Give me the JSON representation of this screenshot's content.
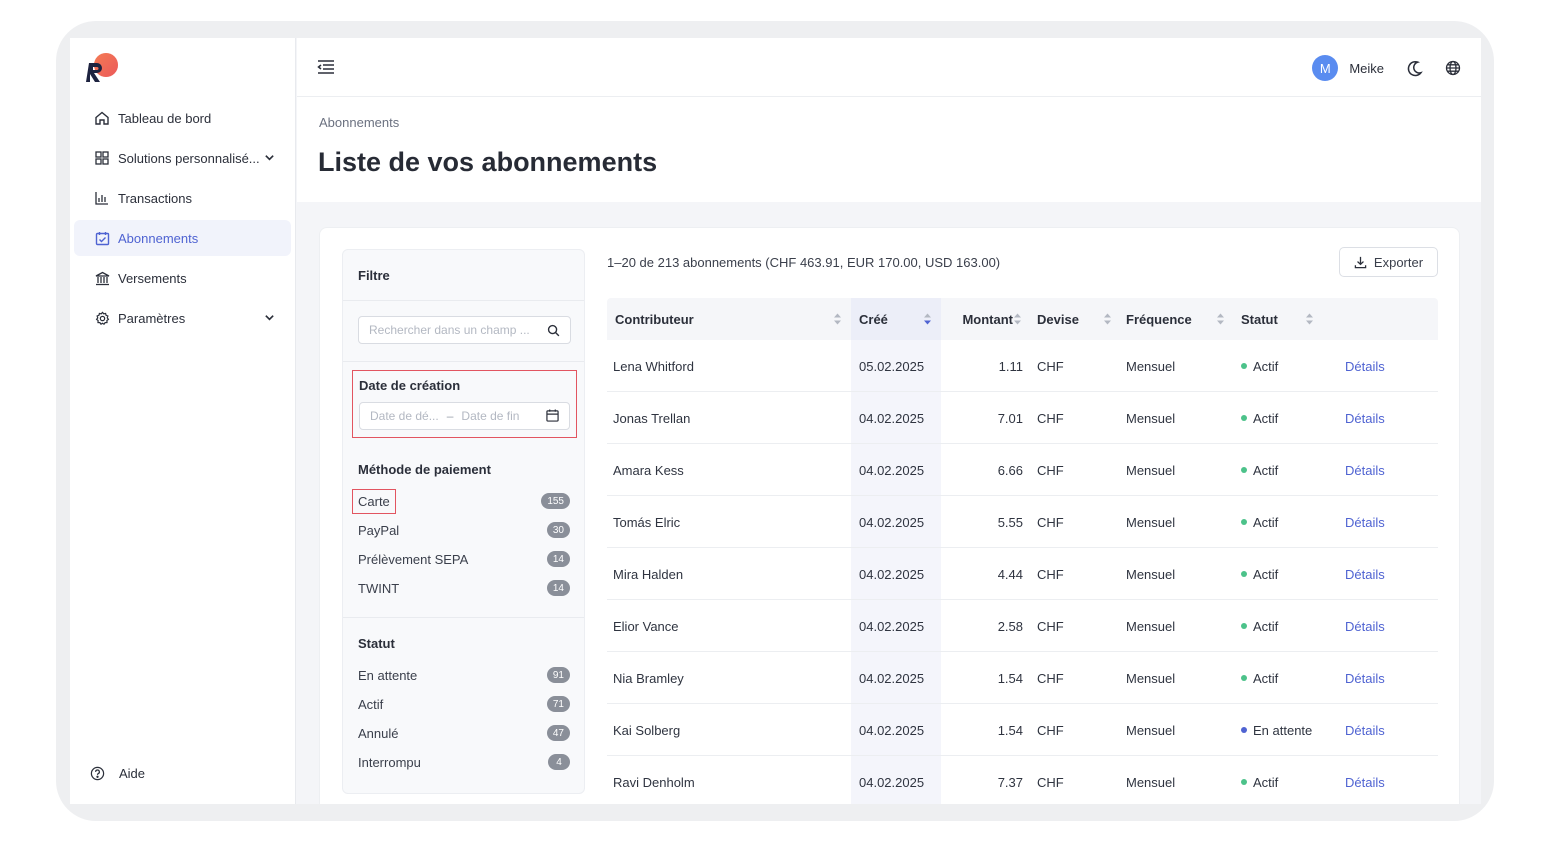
{
  "sidebar": {
    "items": [
      {
        "label": "Tableau de bord",
        "icon": "home-icon"
      },
      {
        "label": "Solutions personnalisé...",
        "icon": "grid-icon"
      },
      {
        "label": "Transactions",
        "icon": "bar-chart-icon"
      },
      {
        "label": "Abonnements",
        "icon": "calendar-check-icon"
      },
      {
        "label": "Versements",
        "icon": "bank-icon"
      },
      {
        "label": "Paramètres",
        "icon": "gear-icon"
      }
    ],
    "help_label": "Aide"
  },
  "topbar": {
    "avatar_initial": "M",
    "username": "Meike"
  },
  "header": {
    "breadcrumb": "Abonnements",
    "title": "Liste de vos abonnements"
  },
  "filter": {
    "title": "Filtre",
    "search_placeholder": "Rechercher dans un champ ...",
    "date": {
      "label": "Date de création",
      "start_placeholder": "Date de dé...",
      "end_placeholder": "Date de fin"
    },
    "payment": {
      "title": "Méthode de paiement",
      "options": [
        {
          "label": "Carte",
          "count": "155"
        },
        {
          "label": "PayPal",
          "count": "30"
        },
        {
          "label": "Prélèvement SEPA",
          "count": "14"
        },
        {
          "label": "TWINT",
          "count": "14"
        }
      ]
    },
    "status": {
      "title": "Statut",
      "options": [
        {
          "label": "En attente",
          "count": "91"
        },
        {
          "label": "Actif",
          "count": "71"
        },
        {
          "label": "Annulé",
          "count": "47"
        },
        {
          "label": "Interrompu",
          "count": "4"
        }
      ]
    }
  },
  "summary": "1–20 de 213 abonnements (CHF 463.91, EUR 170.00, USD 163.00)",
  "export_label": "Exporter",
  "table": {
    "columns": [
      "Contributeur",
      "Créé",
      "Montant",
      "Devise",
      "Fréquence",
      "Statut"
    ],
    "details_label": "Détails",
    "rows": [
      {
        "name": "Lena Whitford",
        "created": "05.02.2025",
        "amount": "1.11",
        "currency": "CHF",
        "frequency": "Mensuel",
        "status": "Actif"
      },
      {
        "name": "Jonas Trellan",
        "created": "04.02.2025",
        "amount": "7.01",
        "currency": "CHF",
        "frequency": "Mensuel",
        "status": "Actif"
      },
      {
        "name": "Amara Kess",
        "created": "04.02.2025",
        "amount": "6.66",
        "currency": "CHF",
        "frequency": "Mensuel",
        "status": "Actif"
      },
      {
        "name": "Tomás Elric",
        "created": "04.02.2025",
        "amount": "5.55",
        "currency": "CHF",
        "frequency": "Mensuel",
        "status": "Actif"
      },
      {
        "name": "Mira Halden",
        "created": "04.02.2025",
        "amount": "4.44",
        "currency": "CHF",
        "frequency": "Mensuel",
        "status": "Actif"
      },
      {
        "name": "Elior Vance",
        "created": "04.02.2025",
        "amount": "2.58",
        "currency": "CHF",
        "frequency": "Mensuel",
        "status": "Actif"
      },
      {
        "name": "Nia Bramley",
        "created": "04.02.2025",
        "amount": "1.54",
        "currency": "CHF",
        "frequency": "Mensuel",
        "status": "Actif"
      },
      {
        "name": "Kai Solberg",
        "created": "04.02.2025",
        "amount": "1.54",
        "currency": "CHF",
        "frequency": "Mensuel",
        "status": "En attente"
      },
      {
        "name": "Ravi Denholm",
        "created": "04.02.2025",
        "amount": "7.37",
        "currency": "CHF",
        "frequency": "Mensuel",
        "status": "Actif"
      }
    ]
  },
  "colors": {
    "accent": "#4f63d2",
    "status_active": "#4cc28a",
    "status_pending": "#4f63d2",
    "highlight_box": "#e25560"
  }
}
